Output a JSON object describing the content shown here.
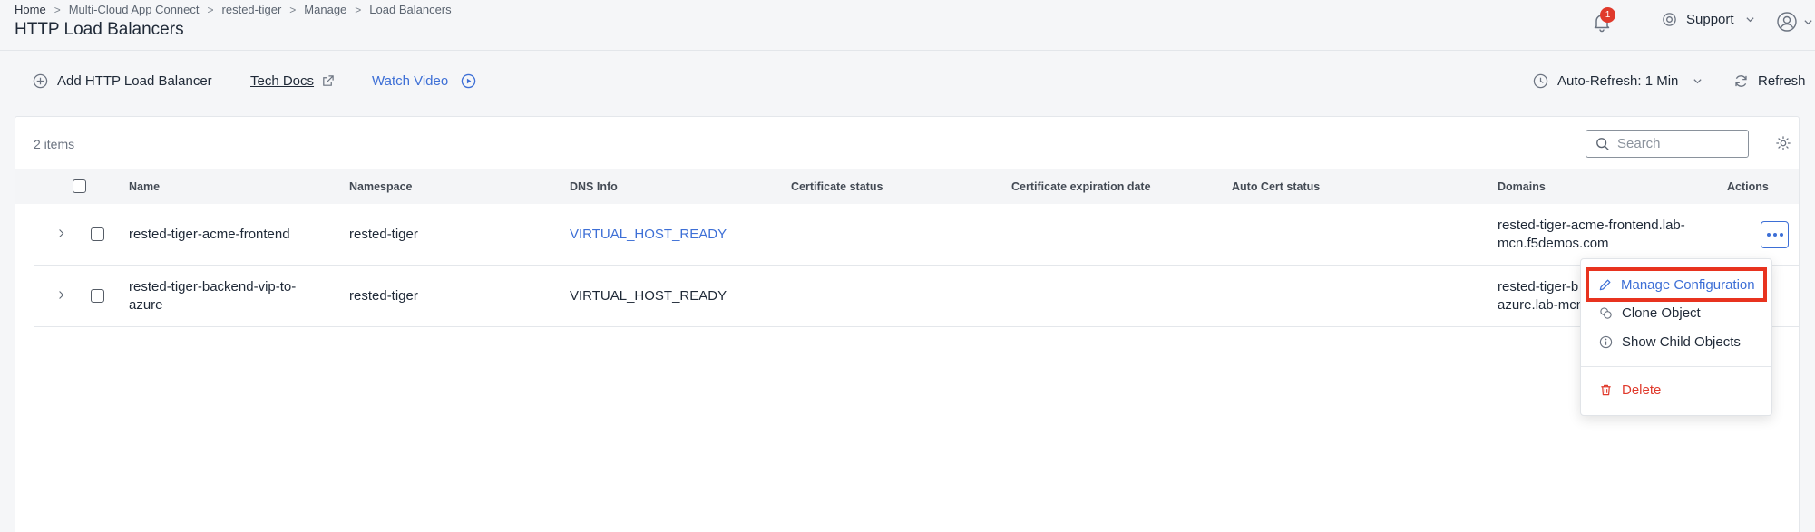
{
  "breadcrumb": {
    "home": "Home",
    "items": [
      "Multi-Cloud App Connect",
      "rested-tiger",
      "Manage",
      "Load Balancers"
    ],
    "separator": ">"
  },
  "page_title": "HTTP Load Balancers",
  "header": {
    "notification_count": "1",
    "support_label": "Support"
  },
  "toolbar": {
    "add_label": "Add HTTP Load Balancer",
    "tech_docs_label": "Tech Docs",
    "watch_video_label": "Watch Video",
    "auto_refresh_label": "Auto-Refresh: 1 Min",
    "refresh_label": "Refresh"
  },
  "table": {
    "items_count": "2 items",
    "search_placeholder": "Search",
    "columns": [
      "Name",
      "Namespace",
      "DNS Info",
      "Certificate status",
      "Certificate expiration date",
      "Auto Cert status",
      "Domains",
      "Actions"
    ],
    "rows": [
      {
        "name": "rested-tiger-acme-frontend",
        "namespace": "rested-tiger",
        "dns_info": "VIRTUAL_HOST_READY",
        "domains_line1": "rested-tiger-acme-frontend.lab-",
        "domains_line2": "mcn.f5demos.com"
      },
      {
        "name_line1": "rested-tiger-backend-vip-to-",
        "name_line2": "azure",
        "namespace": "rested-tiger",
        "dns_info": "VIRTUAL_HOST_READY",
        "domains_line1": "rested-tiger-b",
        "domains_line2": "azure.lab-mcn"
      }
    ]
  },
  "actions_menu": {
    "items": [
      "Manage Configuration",
      "Clone Object",
      "Show Child Objects",
      "Delete"
    ]
  },
  "colors": {
    "accent": "#3d6fd6",
    "danger": "#e03a2c",
    "highlight_border": "#e8331f",
    "background": "#f5f6f8"
  }
}
